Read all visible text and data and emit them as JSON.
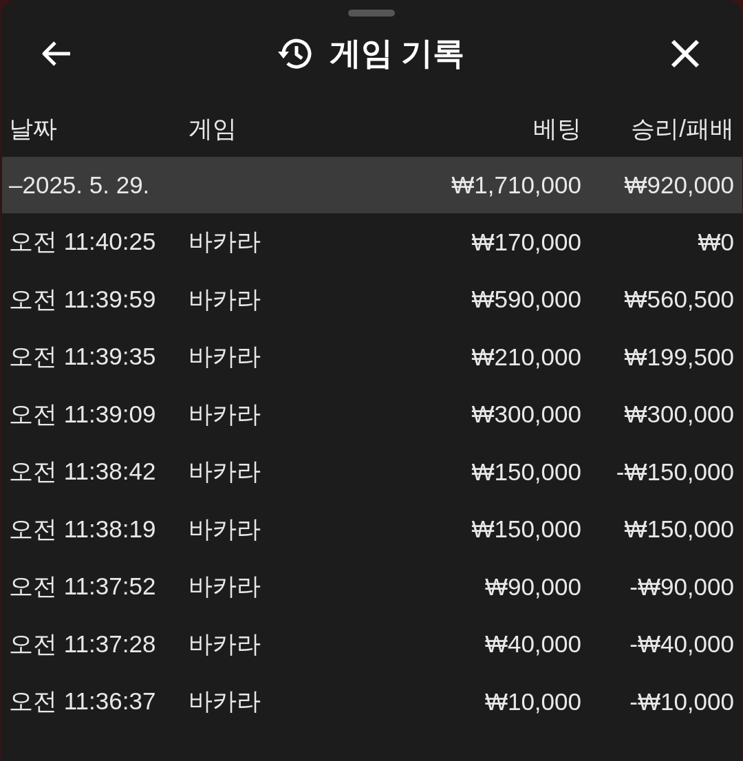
{
  "header": {
    "title": "게임 기록"
  },
  "columns": [
    "날짜",
    "게임",
    "베팅",
    "승리/패배"
  ],
  "group": {
    "date": "–2025. 5. 29.",
    "bet": "₩1,710,000",
    "result": "₩920,000"
  },
  "rows": [
    {
      "time": "오전 11:40:25",
      "game": "바카라",
      "bet": "₩170,000",
      "result": "₩0"
    },
    {
      "time": "오전 11:39:59",
      "game": "바카라",
      "bet": "₩590,000",
      "result": "₩560,500"
    },
    {
      "time": "오전 11:39:35",
      "game": "바카라",
      "bet": "₩210,000",
      "result": "₩199,500"
    },
    {
      "time": "오전 11:39:09",
      "game": "바카라",
      "bet": "₩300,000",
      "result": "₩300,000"
    },
    {
      "time": "오전 11:38:42",
      "game": "바카라",
      "bet": "₩150,000",
      "result": "-₩150,000"
    },
    {
      "time": "오전 11:38:19",
      "game": "바카라",
      "bet": "₩150,000",
      "result": "₩150,000"
    },
    {
      "time": "오전 11:37:52",
      "game": "바카라",
      "bet": "₩90,000",
      "result": "-₩90,000"
    },
    {
      "time": "오전 11:37:28",
      "game": "바카라",
      "bet": "₩40,000",
      "result": "-₩40,000"
    },
    {
      "time": "오전 11:36:37",
      "game": "바카라",
      "bet": "₩10,000",
      "result": "-₩10,000"
    }
  ]
}
